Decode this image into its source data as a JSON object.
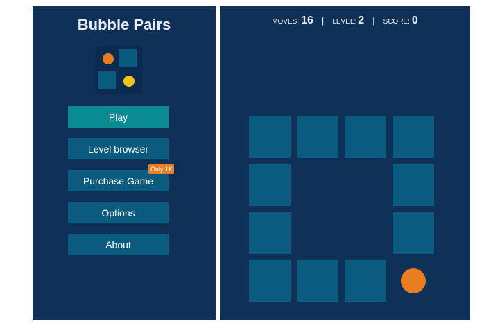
{
  "menu": {
    "title": "Bubble Pairs",
    "buttons": [
      {
        "label": "Play"
      },
      {
        "label": "Level browser"
      },
      {
        "label": "Purchase Game",
        "badge": "Only 1€"
      },
      {
        "label": "Options"
      },
      {
        "label": "About"
      }
    ],
    "logo_colors": {
      "orange": "#e87d22",
      "yellow": "#f1c40f"
    }
  },
  "game": {
    "stats": {
      "moves_label": "MOVES:",
      "moves": "16",
      "level_label": "LEVEL:",
      "level": "2",
      "score_label": "SCORE:",
      "score": "0",
      "separator": "|"
    },
    "board": {
      "rows": [
        [
          "tile",
          "tile",
          "tile",
          "tile"
        ],
        [
          "tile",
          "empty",
          "empty",
          "tile"
        ],
        [
          "tile",
          "empty",
          "empty",
          "tile"
        ],
        [
          "tile",
          "tile",
          "tile",
          "bubble-orange"
        ]
      ]
    }
  },
  "colors": {
    "background": "#0f3057",
    "tile": "#0b5a80",
    "play_button": "#0a8a93",
    "bubble_orange": "#e87d22",
    "bubble_yellow": "#f1c40f"
  }
}
